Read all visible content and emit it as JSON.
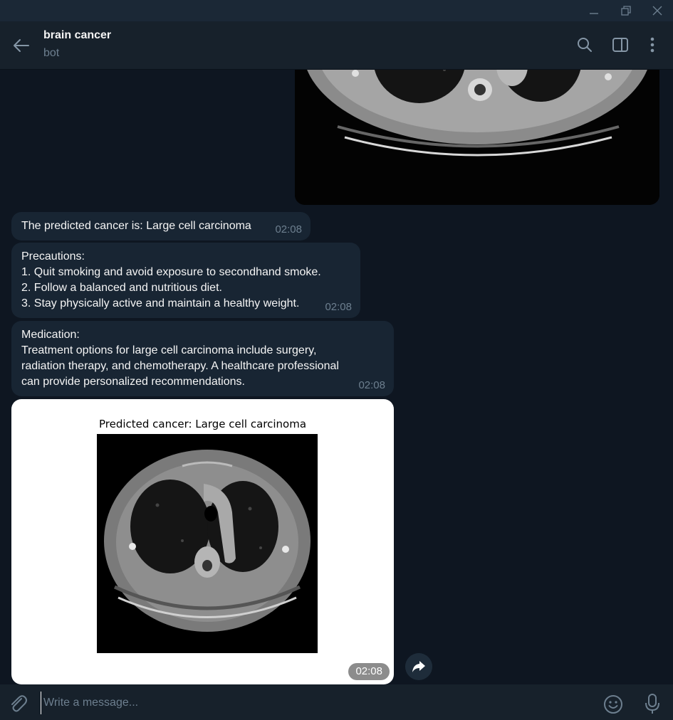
{
  "header": {
    "title": "brain cancer",
    "subtitle": "bot"
  },
  "messages": [
    {
      "text": "The predicted cancer is: Large cell carcinoma",
      "time": "02:08"
    },
    {
      "text": "Precautions:\n1. Quit smoking and avoid exposure to secondhand smoke.\n2. Follow a balanced and nutritious diet.\n3. Stay physically active and maintain a healthy weight.",
      "time": "02:08"
    },
    {
      "text": "Medication:\nTreatment options for large cell carcinoma include surgery,\nradiation therapy, and chemotherapy. A healthcare professional\ncan provide personalized recommendations.",
      "time": "02:08"
    }
  ],
  "image_message": {
    "caption": "Predicted cancer: Large cell carcinoma",
    "time": "02:08"
  },
  "input": {
    "placeholder": "Write a message..."
  },
  "colors": {
    "background": "#0e1621",
    "header": "#17212b",
    "bubble": "#182533",
    "muted_text": "#6d7f8f"
  },
  "icons": {
    "back": "arrow-left-icon",
    "search": "search-icon",
    "panel": "sidebar-toggle-icon",
    "more": "more-vertical-icon",
    "share": "forward-icon",
    "attach": "paperclip-icon",
    "emoji": "emoji-icon",
    "mic": "microphone-icon"
  }
}
